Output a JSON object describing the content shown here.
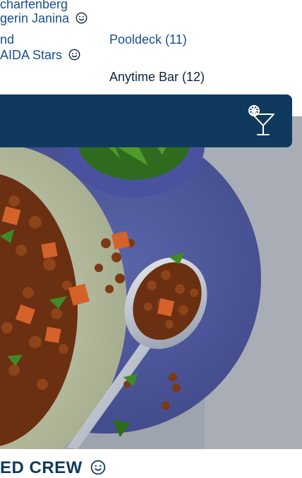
{
  "schedule": {
    "line1": "charfenberg",
    "line2": "gerin Janina",
    "line3": "nd",
    "line4": "AIDA Stars",
    "venue_pooldeck": "Pooldeck (11)",
    "venue_anytime": "Anytime Bar (12)"
  },
  "icons": {
    "bar_icon": "cocktail-glass-icon",
    "smiley": "smiley-icon"
  },
  "colors": {
    "header_bar": "#0f3a5d",
    "link_text": "#1a4f8b",
    "dark_text": "#10243e"
  },
  "section": {
    "bottom_title": "ED CREW"
  }
}
